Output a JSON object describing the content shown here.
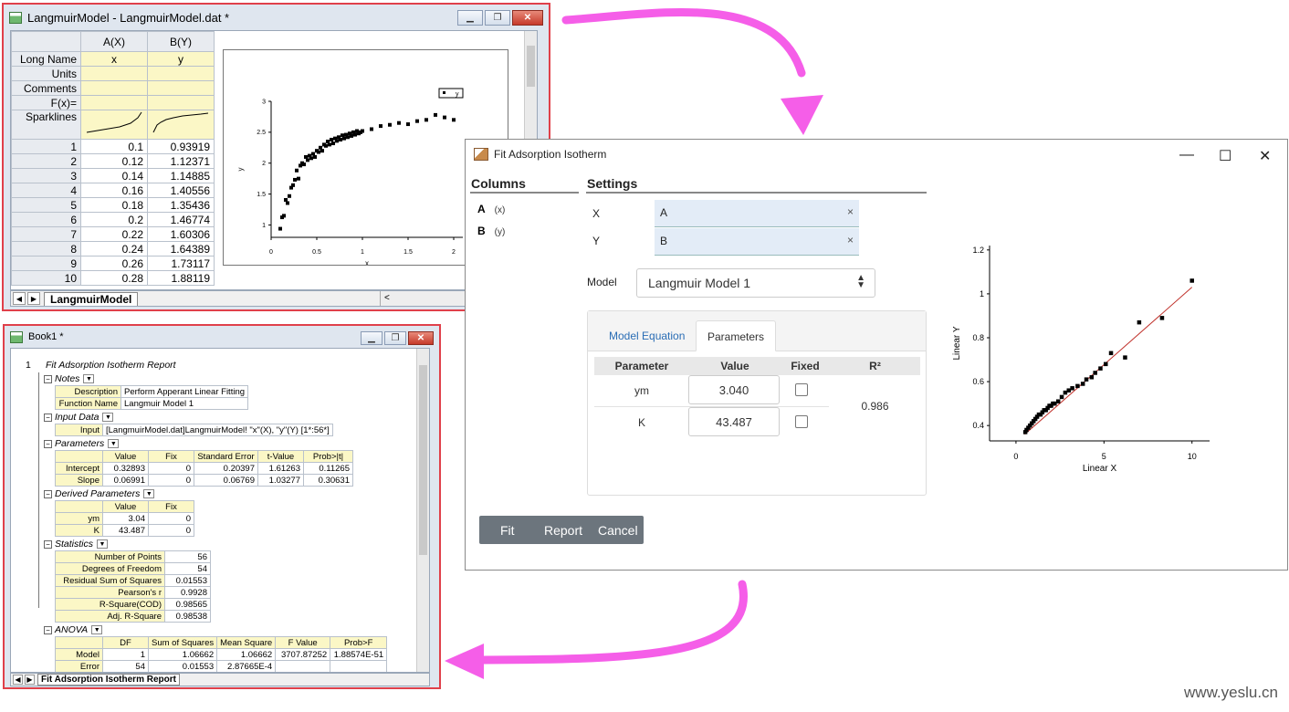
{
  "worksheet": {
    "title": "LangmuirModel - LangmuirModel.dat *",
    "columns": [
      "A(X)",
      "B(Y)"
    ],
    "row_headers": [
      "Long Name",
      "Units",
      "Comments",
      "F(x)=",
      "Sparklines"
    ],
    "long_names": [
      "x",
      "y"
    ],
    "rows": [
      [
        "1",
        "0.1",
        "0.93919"
      ],
      [
        "2",
        "0.12",
        "1.12371"
      ],
      [
        "3",
        "0.14",
        "1.14885"
      ],
      [
        "4",
        "0.16",
        "1.40556"
      ],
      [
        "5",
        "0.18",
        "1.35436"
      ],
      [
        "6",
        "0.2",
        "1.46774"
      ],
      [
        "7",
        "0.22",
        "1.60306"
      ],
      [
        "8",
        "0.24",
        "1.64389"
      ],
      [
        "9",
        "0.26",
        "1.73117"
      ],
      [
        "10",
        "0.28",
        "1.88119"
      ]
    ],
    "sheet_tab": "LangmuirModel",
    "scroll_left": "<"
  },
  "report": {
    "title": "Book1 *",
    "row_num": "1",
    "heading": "Fit Adsorption Isotherm Report",
    "tab": "Fit Adsorption Isotherm Report",
    "notes": {
      "label": "Notes",
      "rows": [
        [
          "Description",
          "Perform Apperant Linear Fitting"
        ],
        [
          "Function Name",
          "Langmuir Model 1"
        ]
      ]
    },
    "input": {
      "label": "Input Data",
      "key": "Input",
      "value": "[LangmuirModel.dat]LangmuirModel! \"x\"(X), \"y\"(Y) [1*:56*]"
    },
    "parameters": {
      "label": "Parameters",
      "headers": [
        "",
        "Value",
        "Fix",
        "Standard Error",
        "t-Value",
        "Prob>|t|"
      ],
      "rows": [
        [
          "Intercept",
          "0.32893",
          "0",
          "0.20397",
          "1.61263",
          "0.11265"
        ],
        [
          "Slope",
          "0.06991",
          "0",
          "0.06769",
          "1.03277",
          "0.30631"
        ]
      ]
    },
    "derived": {
      "label": "Derived Parameters",
      "headers": [
        "",
        "Value",
        "Fix"
      ],
      "rows": [
        [
          "ym",
          "3.04",
          "0"
        ],
        [
          "K",
          "43.487",
          "0"
        ]
      ]
    },
    "statistics": {
      "label": "Statistics",
      "rows": [
        [
          "Number of Points",
          "56"
        ],
        [
          "Degrees of Freedom",
          "54"
        ],
        [
          "Residual Sum of Squares",
          "0.01553"
        ],
        [
          "Pearson's r",
          "0.9928"
        ],
        [
          "R-Square(COD)",
          "0.98565"
        ],
        [
          "Adj. R-Square",
          "0.98538"
        ]
      ]
    },
    "anova": {
      "label": "ANOVA",
      "headers": [
        "",
        "DF",
        "Sum of Squares",
        "Mean Square",
        "F Value",
        "Prob>F"
      ],
      "rows": [
        [
          "Model",
          "1",
          "1.06662",
          "1.06662",
          "3707.87252",
          "1.88574E-51"
        ],
        [
          "Error",
          "54",
          "0.01553",
          "2.87665E-4",
          "",
          ""
        ]
      ]
    }
  },
  "dialog": {
    "title": "Fit Adsorption Isotherm",
    "columns_label": "Columns",
    "settings_label": "Settings",
    "column_items": [
      {
        "name": "A",
        "role": "(x)"
      },
      {
        "name": "B",
        "role": "(y)"
      }
    ],
    "x_label": "X",
    "x_value": "A",
    "y_label": "Y",
    "y_value": "B",
    "clear_glyph": "×",
    "model_label": "Model",
    "model_value": "Langmuir Model 1",
    "tabs": [
      "Model Equation",
      "Parameters"
    ],
    "param_headers": [
      "Parameter",
      "Value",
      "Fixed",
      "R²"
    ],
    "params": [
      {
        "name": "ym",
        "value": "3.040"
      },
      {
        "name": "K",
        "value": "43.487"
      }
    ],
    "r2": "0.986",
    "buttons": [
      "Fit",
      "Report",
      "Cancel"
    ]
  },
  "chart_data": [
    {
      "type": "scatter",
      "title": "",
      "xlabel": "x",
      "ylabel": "y",
      "legend": "y",
      "xlim": [
        0,
        2.1
      ],
      "ylim": [
        0.8,
        3.0
      ],
      "xticks": [
        "0",
        "0.5",
        "1",
        "1.5",
        "2"
      ],
      "yticks": [
        "1",
        "1.5",
        "2",
        "2.5",
        "3"
      ],
      "series": [
        {
          "name": "y",
          "x": [
            0.1,
            0.12,
            0.14,
            0.16,
            0.18,
            0.2,
            0.22,
            0.24,
            0.26,
            0.28,
            0.3,
            0.32,
            0.34,
            0.36,
            0.38,
            0.4,
            0.42,
            0.44,
            0.46,
            0.48,
            0.5,
            0.52,
            0.54,
            0.56,
            0.58,
            0.6,
            0.62,
            0.64,
            0.66,
            0.68,
            0.7,
            0.72,
            0.74,
            0.76,
            0.78,
            0.8,
            0.82,
            0.84,
            0.86,
            0.88,
            0.9,
            0.92,
            0.94,
            0.96,
            0.98,
            1.0,
            1.1,
            1.2,
            1.3,
            1.4,
            1.5,
            1.6,
            1.7,
            1.8,
            1.9,
            2.0
          ],
          "y": [
            0.93919,
            1.12371,
            1.14885,
            1.40556,
            1.35436,
            1.46774,
            1.60306,
            1.64389,
            1.73117,
            1.88119,
            1.75,
            1.96,
            2.0,
            1.98,
            2.1,
            2.05,
            2.12,
            2.08,
            2.15,
            2.1,
            2.2,
            2.18,
            2.25,
            2.2,
            2.3,
            2.28,
            2.35,
            2.3,
            2.38,
            2.32,
            2.4,
            2.36,
            2.42,
            2.38,
            2.45,
            2.4,
            2.46,
            2.42,
            2.48,
            2.44,
            2.5,
            2.46,
            2.52,
            2.48,
            2.5,
            2.52,
            2.55,
            2.6,
            2.62,
            2.65,
            2.63,
            2.68,
            2.7,
            2.78,
            2.74,
            2.7
          ]
        }
      ]
    },
    {
      "type": "scatter",
      "title": "",
      "xlabel": "Linear X",
      "ylabel": "Linear Y",
      "xlim": [
        -1.5,
        11
      ],
      "ylim": [
        0.33,
        1.22
      ],
      "xticks": [
        "0",
        "5",
        "10"
      ],
      "yticks": [
        "0.4",
        "0.6",
        "0.8",
        "1",
        "1.2"
      ],
      "fit_line": {
        "x": [
          0.5,
          10
        ],
        "y": [
          0.36,
          1.03
        ]
      },
      "series": [
        {
          "x": [
            0.53,
            0.6,
            0.7,
            0.8,
            0.9,
            1.0,
            1.1,
            1.2,
            1.3,
            1.4,
            1.5,
            1.6,
            1.7,
            1.8,
            1.9,
            2.0,
            2.1,
            2.2,
            2.4,
            2.6,
            2.8,
            3.0,
            3.2,
            3.5,
            3.8,
            4.0,
            4.3,
            4.5,
            4.8,
            5.1,
            5.4,
            6.2,
            7.0,
            8.3,
            10.0
          ],
          "y": [
            0.37,
            0.38,
            0.39,
            0.4,
            0.41,
            0.42,
            0.43,
            0.44,
            0.45,
            0.45,
            0.46,
            0.47,
            0.47,
            0.48,
            0.49,
            0.49,
            0.5,
            0.5,
            0.51,
            0.53,
            0.55,
            0.56,
            0.57,
            0.58,
            0.59,
            0.61,
            0.62,
            0.64,
            0.66,
            0.68,
            0.73,
            0.71,
            0.87,
            0.89,
            1.06
          ]
        }
      ]
    }
  ],
  "watermark": "www.yeslu.cn"
}
